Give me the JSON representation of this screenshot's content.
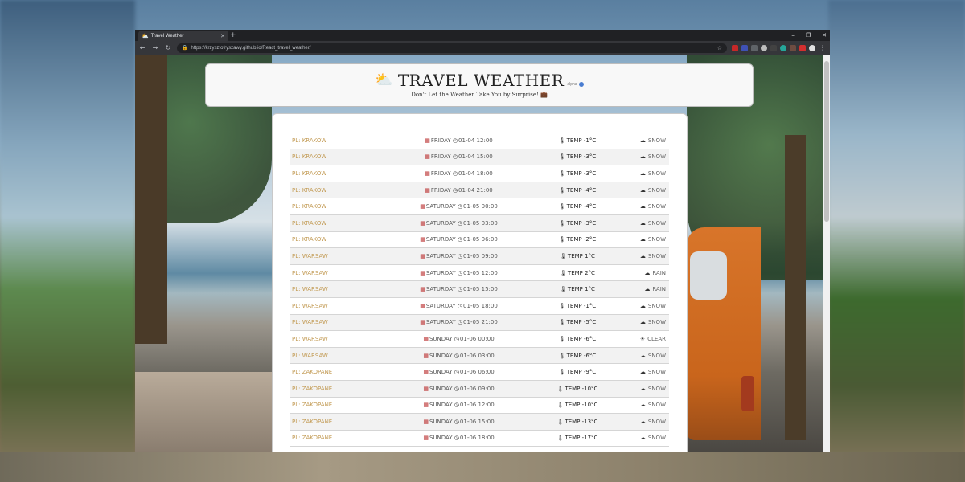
{
  "browser": {
    "tab_title": "Travel Weather",
    "url": "https://krzysztofryszawy.github.io/React_travel_weather/",
    "new_tab_label": "+",
    "window_controls": [
      "–",
      "❐",
      "✕"
    ]
  },
  "header": {
    "title": "TRAVEL WEATHER",
    "badge": "alpha",
    "subtitle": "Don't Let the Weather Take You by Surprise!"
  },
  "forecast": [
    {
      "city": "PL: KRAKOW",
      "day": "FRIDAY",
      "datetime": "01-04 12:00",
      "temp": "TEMP -1°C",
      "weather": "SNOW",
      "wx_icon": "☁"
    },
    {
      "city": "PL: KRAKOW",
      "day": "FRIDAY",
      "datetime": "01-04 15:00",
      "temp": "TEMP -3°C",
      "weather": "SNOW",
      "wx_icon": "☁"
    },
    {
      "city": "PL: KRAKOW",
      "day": "FRIDAY",
      "datetime": "01-04 18:00",
      "temp": "TEMP -3°C",
      "weather": "SNOW",
      "wx_icon": "☁"
    },
    {
      "city": "PL: KRAKOW",
      "day": "FRIDAY",
      "datetime": "01-04 21:00",
      "temp": "TEMP -4°C",
      "weather": "SNOW",
      "wx_icon": "☁"
    },
    {
      "city": "PL: KRAKOW",
      "day": "SATURDAY",
      "datetime": "01-05 00:00",
      "temp": "TEMP -4°C",
      "weather": "SNOW",
      "wx_icon": "☁"
    },
    {
      "city": "PL: KRAKOW",
      "day": "SATURDAY",
      "datetime": "01-05 03:00",
      "temp": "TEMP -3°C",
      "weather": "SNOW",
      "wx_icon": "☁"
    },
    {
      "city": "PL: KRAKOW",
      "day": "SATURDAY",
      "datetime": "01-05 06:00",
      "temp": "TEMP -2°C",
      "weather": "SNOW",
      "wx_icon": "☁"
    },
    {
      "city": "PL: WARSAW",
      "day": "SATURDAY",
      "datetime": "01-05 09:00",
      "temp": "TEMP 1°C",
      "weather": "SNOW",
      "wx_icon": "☁"
    },
    {
      "city": "PL: WARSAW",
      "day": "SATURDAY",
      "datetime": "01-05 12:00",
      "temp": "TEMP 2°C",
      "weather": "RAIN",
      "wx_icon": "☁"
    },
    {
      "city": "PL: WARSAW",
      "day": "SATURDAY",
      "datetime": "01-05 15:00",
      "temp": "TEMP 1°C",
      "weather": "RAIN",
      "wx_icon": "☁"
    },
    {
      "city": "PL: WARSAW",
      "day": "SATURDAY",
      "datetime": "01-05 18:00",
      "temp": "TEMP -1°C",
      "weather": "SNOW",
      "wx_icon": "☁"
    },
    {
      "city": "PL: WARSAW",
      "day": "SATURDAY",
      "datetime": "01-05 21:00",
      "temp": "TEMP -5°C",
      "weather": "SNOW",
      "wx_icon": "☁"
    },
    {
      "city": "PL: WARSAW",
      "day": "SUNDAY",
      "datetime": "01-06 00:00",
      "temp": "TEMP -6°C",
      "weather": "CLEAR",
      "wx_icon": "☀"
    },
    {
      "city": "PL: WARSAW",
      "day": "SUNDAY",
      "datetime": "01-06 03:00",
      "temp": "TEMP -6°C",
      "weather": "SNOW",
      "wx_icon": "☁"
    },
    {
      "city": "PL: ZAKOPANE",
      "day": "SUNDAY",
      "datetime": "01-06 06:00",
      "temp": "TEMP -9°C",
      "weather": "SNOW",
      "wx_icon": "☁"
    },
    {
      "city": "PL: ZAKOPANE",
      "day": "SUNDAY",
      "datetime": "01-06 09:00",
      "temp": "TEMP -10°C",
      "weather": "SNOW",
      "wx_icon": "☁"
    },
    {
      "city": "PL: ZAKOPANE",
      "day": "SUNDAY",
      "datetime": "01-06 12:00",
      "temp": "TEMP -10°C",
      "weather": "SNOW",
      "wx_icon": "☁"
    },
    {
      "city": "PL: ZAKOPANE",
      "day": "SUNDAY",
      "datetime": "01-06 15:00",
      "temp": "TEMP -13°C",
      "weather": "SNOW",
      "wx_icon": "☁"
    },
    {
      "city": "PL: ZAKOPANE",
      "day": "SUNDAY",
      "datetime": "01-06 18:00",
      "temp": "TEMP -17°C",
      "weather": "SNOW",
      "wx_icon": "☁"
    }
  ],
  "colors": {
    "city_text": "#c29a53",
    "accent_sun": "#e6b120"
  }
}
